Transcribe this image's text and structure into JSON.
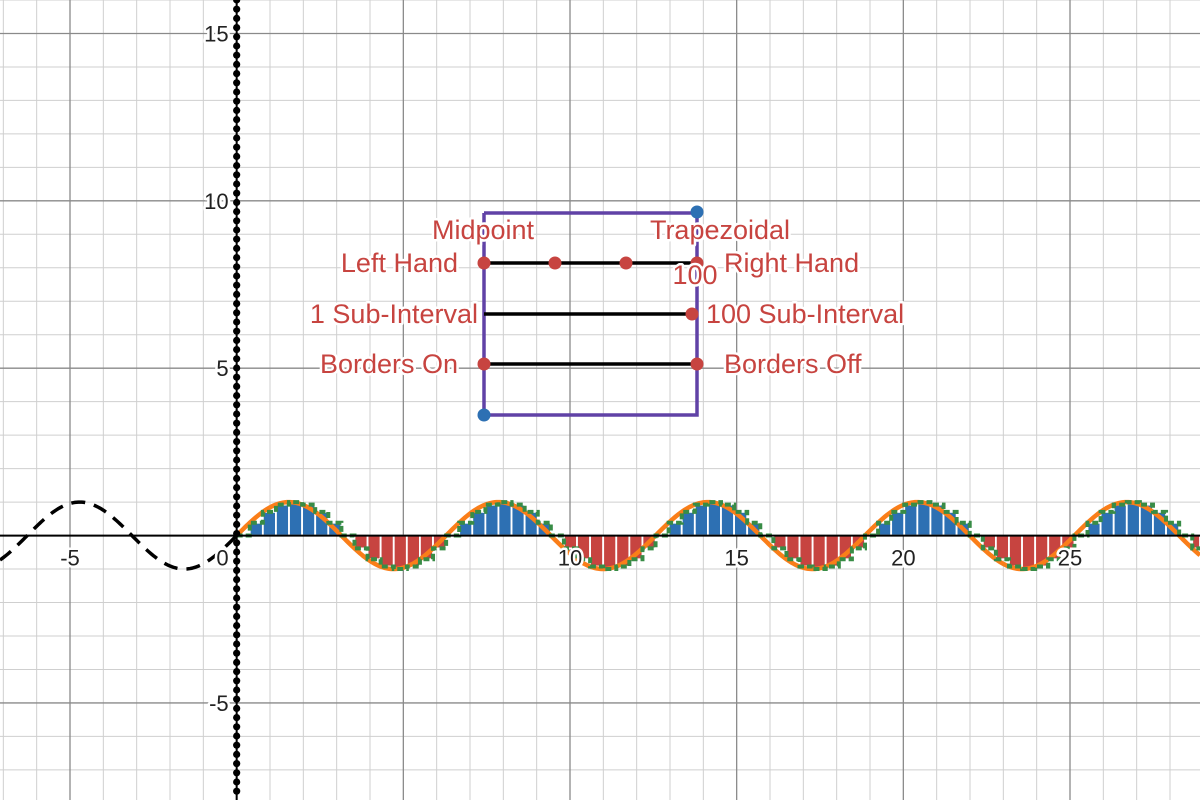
{
  "chart_data": {
    "type": "line",
    "title": "",
    "xlabel": "",
    "ylabel": "",
    "xlim": [
      -7.1,
      28.9
    ],
    "ylim": [
      -7.9,
      16.0
    ],
    "grid": true,
    "x_ticks": [
      -5,
      0,
      10,
      15,
      20,
      25
    ],
    "y_ticks": [
      -5,
      5,
      10,
      15
    ],
    "x_tick_labels": [
      "-5",
      "0",
      "10",
      "15",
      "20",
      "25"
    ],
    "y_tick_labels": [
      "-5",
      "5",
      "10",
      "15"
    ],
    "function": {
      "expression": "sin(x)",
      "amplitude": 1,
      "period": 6.2832,
      "dashed_segment_x": [
        -7.1,
        0
      ],
      "integral_x": [
        0,
        28.9
      ],
      "sub_intervals": 100
    },
    "series": [
      {
        "style": "dashed-black",
        "color": "#000000"
      },
      {
        "style": "left-riemann-positive",
        "color": "#2d70b3"
      },
      {
        "style": "left-riemann-negative",
        "color": "#c74440"
      },
      {
        "style": "trapezoidal-curve",
        "color": "#fa7e19"
      },
      {
        "style": "step-outline",
        "color": "#388c46"
      }
    ],
    "colors": {
      "axis": "#000000",
      "control_text": "#c74440",
      "control_point": "#c74440",
      "panel_border": "#6042a6",
      "panel_handle": "#2d70b3"
    }
  },
  "controls": {
    "method_labels": {
      "midpoint": "Midpoint",
      "trapezoidal": "Trapezoidal",
      "left_hand": "Left Hand",
      "right_hand": "Right Hand"
    },
    "sub_interval_labels": {
      "min": "1 Sub-Interval",
      "max": "100 Sub-Interval",
      "current": "100"
    },
    "border_labels": {
      "on": "Borders On",
      "off": "Borders Off"
    }
  }
}
